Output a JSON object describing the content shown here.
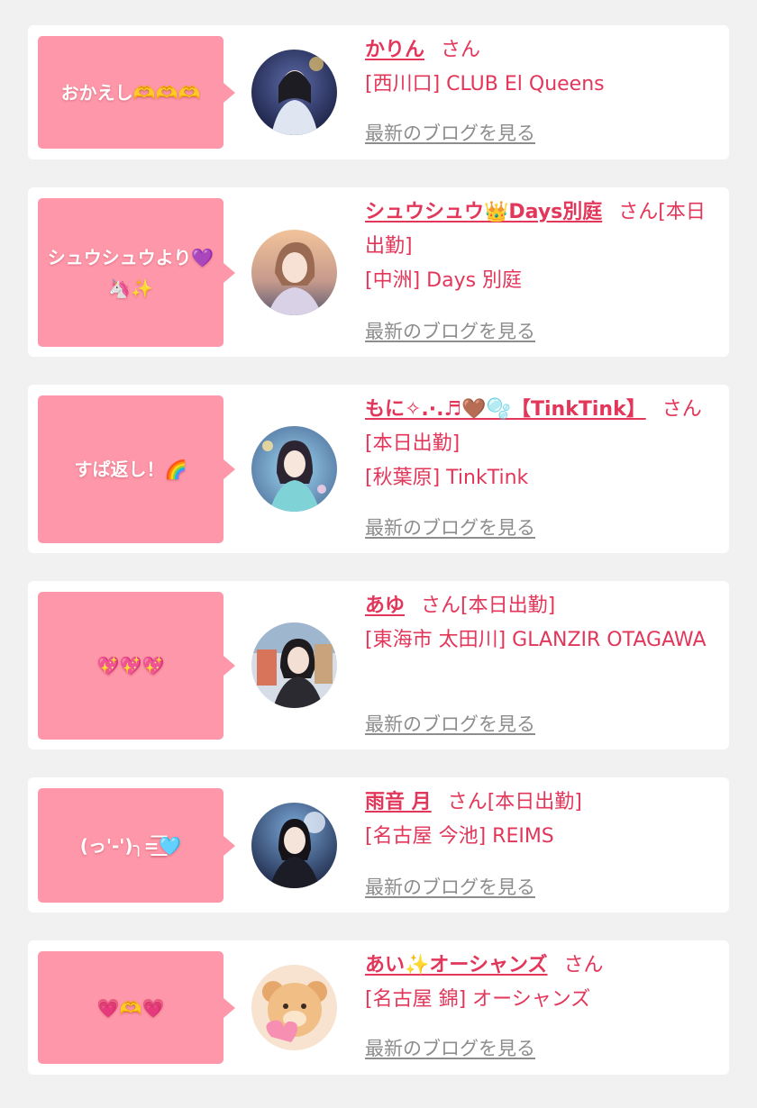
{
  "colors": {
    "page_background": "#f1f1f1",
    "card_background": "#ffffff",
    "bubble_pink": "#fe97a9",
    "accent_text": "#e2365a",
    "link_gray": "#8d8d8d"
  },
  "entries": [
    {
      "message": "おかえし🫶🫶🫶",
      "name": "かりん",
      "honorific": "さん",
      "status": "",
      "area_shop": "[西川口] CLUB El Queens",
      "blog_link": "最新のブログを見る",
      "avatar": "profile-photo"
    },
    {
      "message": "シュウシュウより💜🦄✨",
      "name": "シュウシュウ👑Days別庭",
      "honorific": "さん",
      "status": "[本日出勤]",
      "area_shop": "[中洲] Days 別庭",
      "blog_link": "最新のブログを見る",
      "avatar": "profile-photo"
    },
    {
      "message": "すぱ返し！🌈",
      "name": "もに✧.·.♬🤎🫧【TinkTink】",
      "honorific": "さん",
      "status": "[本日出勤]",
      "area_shop": "[秋葉原] TinkTink",
      "blog_link": "最新のブログを見る",
      "avatar": "profile-photo"
    },
    {
      "message": "💖💖💖",
      "name": "あゆ",
      "honorific": "さん",
      "status": "[本日出勤]",
      "area_shop": "[東海市 太田川] GLANZIR OTAGAWA",
      "blog_link": "最新のブログを見る",
      "avatar": "profile-photo"
    },
    {
      "message": "(っ'-')╮=͟͟͞͞🩵",
      "name": "雨音 月",
      "honorific": "さん",
      "status": "[本日出勤]",
      "area_shop": "[名古屋 今池] REIMS",
      "blog_link": "最新のブログを見る",
      "avatar": "profile-photo"
    },
    {
      "message": "💗🫶💗",
      "name": "あい✨オーシャンズ",
      "honorific": "さん",
      "status": "",
      "area_shop": "[名古屋 錦] オーシャンズ",
      "blog_link": "最新のブログを見る",
      "avatar": "bear-character-image"
    }
  ]
}
